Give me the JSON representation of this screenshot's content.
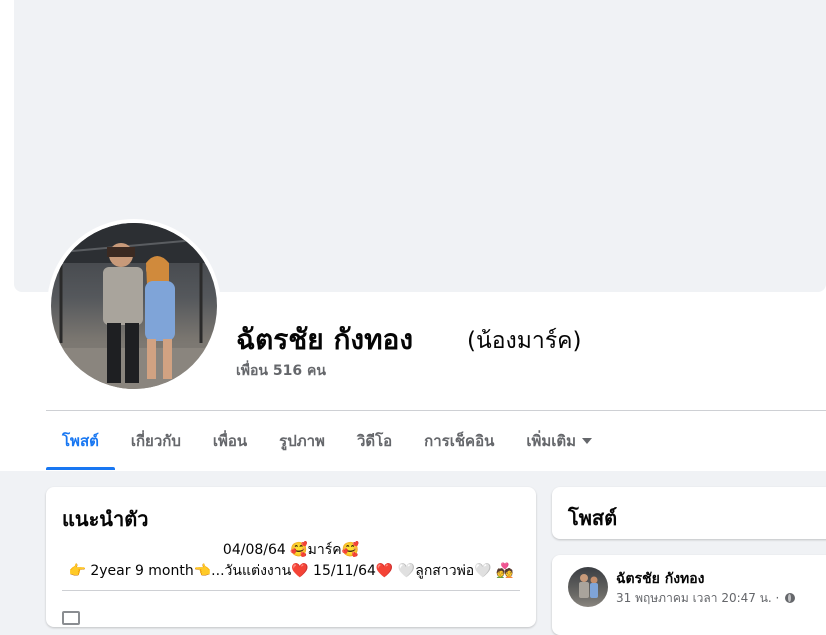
{
  "profile": {
    "name": "ฉัตรชัย กังทอง",
    "alternate_name": "(น้องมาร์ค)",
    "friends": "เพื่อน 516 คน"
  },
  "tabs": [
    {
      "label": "โพสต์",
      "active": true
    },
    {
      "label": "เกี่ยวกับ",
      "active": false
    },
    {
      "label": "เพื่อน",
      "active": false
    },
    {
      "label": "รูปภาพ",
      "active": false
    },
    {
      "label": "วิดีโอ",
      "active": false
    },
    {
      "label": "การเช็คอิน",
      "active": false
    },
    {
      "label": "เพิ่มเติม",
      "active": false
    }
  ],
  "intro": {
    "title": "แนะนำตัว",
    "bio_line1": "04/08/64 🥰มาร์ค🥰",
    "bio_line2": "👉 2year 9 month👈...วันแต่งงาน❤️ 15/11/64❤️ 🤍ลูกสาวพ่อ🤍 💑"
  },
  "posts_section": {
    "title": "โพสต์"
  },
  "post": {
    "author": "ฉัตรชัย กังทอง",
    "meta": "31 พฤษภาคม เวลา 20:47 น. ·",
    "privacy_icon": "globe-icon"
  },
  "colors": {
    "accent": "#1877f2",
    "background": "#f0f2f5",
    "secondary_text": "#65676b"
  }
}
